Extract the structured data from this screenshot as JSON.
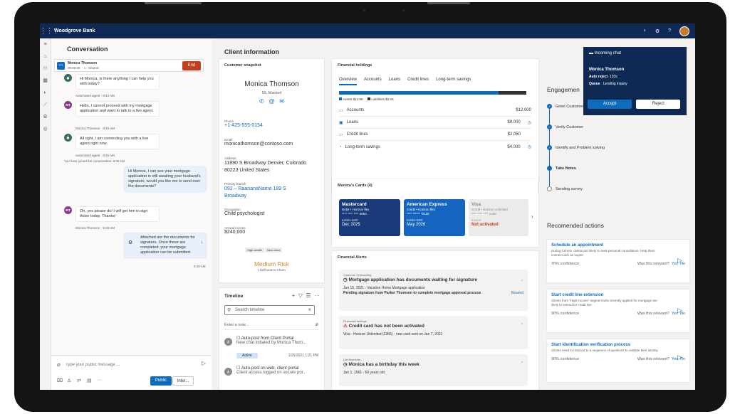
{
  "app": {
    "title": "Woodgrove Bank"
  },
  "conversation": {
    "title": "Conversation",
    "caller": {
      "name": "Monica Thomson",
      "timer": "00:00:35",
      "sentiment": "Neutral",
      "end_label": "End"
    },
    "messages": [
      {
        "text": "Hi Monica, is there anything I can help you with today?",
        "meta": "Automated agent · 9:43 AM"
      },
      {
        "text": "Hello, I cannot proceed with my mortgage application and want to talk to a live agent.",
        "meta": "Monica Thomson · 9:46 AM",
        "initials": "MT"
      },
      {
        "text": "All right, I am connecting you with a live agent right now.",
        "meta": "Automated agent · 9:46 AM"
      },
      {
        "text": "Hi Monica, I can see your mortgage application is still awaiting your husband's signature, would you like me to send over the documents?"
      },
      {
        "text": "Oh, yes please do! I will get him to sign those today. Thanks!",
        "meta": "Monica Thomson · 9:48 AM",
        "initials": "MT"
      },
      {
        "text": "Attached are the documents for signature. Once these are completed, your mortgage application can be submitted.",
        "meta": "9:49 AM"
      }
    ],
    "system_note": "You have joined the conversation. 9:46 AM",
    "composer": {
      "placeholder": "Type your public message ...",
      "public_label": "Public",
      "internal_label": "Inter..."
    }
  },
  "client": {
    "title": "Client information",
    "snapshot_label": "Customer snapshot",
    "name": "Monica Thomson",
    "age_status": "59, Married",
    "fields": [
      {
        "label": "Phone",
        "value": "+1-425-555-0154",
        "link": true
      },
      {
        "label": "Email",
        "value": "monicathomson@contoso.com"
      },
      {
        "label": "Address",
        "value": "11890 S Broadway Denver, Colorado 80223 United States"
      },
      {
        "label": "Primary branch",
        "value": "092 – RaananaName 189 S Broadway",
        "link": true
      },
      {
        "label": "Occupation",
        "value": "Child psychologist"
      },
      {
        "label": "Annual income",
        "value": "$240,000"
      }
    ],
    "tags": [
      "High wealth",
      "New client"
    ],
    "risk": "Medium Risk",
    "risk_sub": "Likelihood to Churn"
  },
  "timeline": {
    "title": "Timeline",
    "search_placeholder": "Search timeline",
    "note_placeholder": "Enter a note...",
    "items": [
      {
        "title": "Auto-post from Client Portal",
        "sub": "New chat initiated by Monica Thom..."
      },
      {
        "badge": "Active",
        "date": "1/25/2021 1:21 PM"
      },
      {
        "title": "Auto-post on web: client portal",
        "sub": "Client access logged on secure por.."
      }
    ]
  },
  "holdings": {
    "title": "Financial holdings",
    "tabs": [
      "Overview",
      "Accounts",
      "Loans",
      "Credit lines",
      "Long-term savings"
    ],
    "assets_label": "Assets $14.5K",
    "liabilities_label": "Liabilities $2.5K",
    "assets_fraction": 0.853,
    "rows": [
      {
        "name": "Accounts",
        "amount": "$12,000"
      },
      {
        "name": "Loans",
        "amount": "$9,000"
      },
      {
        "name": "Credit lines",
        "amount": "$2,050"
      },
      {
        "name": "Long-term savings",
        "amount": "$4,000"
      }
    ]
  },
  "cards": {
    "title": "Monica's Cards (4)",
    "items": [
      {
        "name": "Mastercard",
        "sub": "Debit • Horizon flex",
        "num": "**** **** **** 5853",
        "exp_label": "EXPIRY DATE",
        "exp": "Dec 2025",
        "color": "#1b3a7a"
      },
      {
        "name": "American Express",
        "sub": "Credit • Horizon flex",
        "num": "**** ****** *2118",
        "exp_label": "EXPIRY DATE",
        "exp": "May 2026",
        "color": "#1565c0"
      },
      {
        "name": "Visa",
        "sub": "Credit • Horizon unlimited",
        "num": "**** **** **** 2366",
        "exp_label": "STATUS",
        "exp": "Not activated",
        "color": "#edebe9"
      }
    ]
  },
  "alerts": {
    "title": "Financial Alerts",
    "items": [
      {
        "cat": "Customer Onboarding",
        "title": "Mortgage application has documents waiting for signature",
        "l1": "Jan 15, 2021 - Vacation Home Mortgage application",
        "l2": "Pending signature from Parker Thomson to complete mortgage approval process",
        "action": "Resend"
      },
      {
        "cat": "Financial Holdings",
        "title": "Credit card has not been activated",
        "l1": "Visa - Horizon Unlimited (2366) - new card sent on Jan 7, 2021"
      },
      {
        "cat": "Life Moments",
        "title": "Monica has a birthday this week",
        "l1": "Jan 1, 1961 - 60 years old"
      }
    ]
  },
  "engagement": {
    "title": "Engagemen",
    "steps": [
      "Greet Customer",
      "Verify Customer",
      "Identify and Problem solving",
      "Take Notes",
      "Sending survey"
    ]
  },
  "recommended": {
    "title": "Recomended actions",
    "items": [
      {
        "title": "Schedule an appointment",
        "desc": "During COVID, clients are likely to seek personal consultation. Help them connect with an expert",
        "confidence": "76% confidence"
      },
      {
        "title": "Start credit line extension",
        "desc": "Clients from \"High income\" segment who recently applied for mortgage are likely to extend for credit line",
        "confidence": "90% confidence"
      },
      {
        "title": "Start identification verification process",
        "desc": "Clients need to respond to a sequence of questions to validate their identity",
        "confidence": "90% confidence"
      }
    ],
    "relevant": "Was this relevant?",
    "yes": "Yes",
    "no": "No"
  },
  "incoming": {
    "title": "Incoming chat",
    "name": "Monica Thomson",
    "auto_reject_label": "Auto reject",
    "auto_reject": "120s",
    "queue_label": "Queue",
    "queue": "Lending inquiry",
    "accept": "Accept",
    "reject": "Reject"
  }
}
